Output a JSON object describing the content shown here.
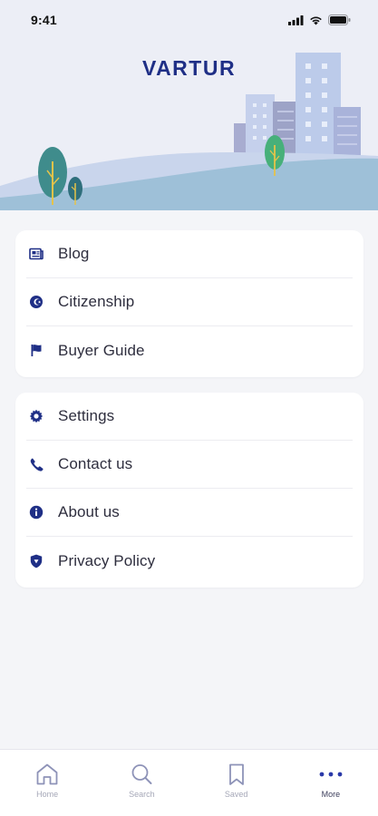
{
  "status_bar": {
    "time": "9:41"
  },
  "header": {
    "brand": "VARTUR"
  },
  "menu_group_1": [
    {
      "label": "Blog",
      "icon": "newspaper-icon"
    },
    {
      "label": "Citizenship",
      "icon": "passport-icon"
    },
    {
      "label": "Buyer Guide",
      "icon": "flag-icon"
    }
  ],
  "menu_group_2": [
    {
      "label": "Settings",
      "icon": "gear-icon"
    },
    {
      "label": "Contact us",
      "icon": "phone-icon"
    },
    {
      "label": "About us",
      "icon": "info-icon"
    },
    {
      "label": "Privacy Policy",
      "icon": "shield-icon"
    }
  ],
  "tab_bar": [
    {
      "label": "Home",
      "icon": "home-icon",
      "active": false
    },
    {
      "label": "Search",
      "icon": "search-icon",
      "active": false
    },
    {
      "label": "Saved",
      "icon": "bookmark-icon",
      "active": false
    },
    {
      "label": "More",
      "icon": "more-dots-icon",
      "active": true
    }
  ],
  "colors": {
    "brand": "#1f2f86",
    "icon": "#1f2f86",
    "tab_inactive": "#8e93b8",
    "tab_active": "#2a39a8"
  }
}
